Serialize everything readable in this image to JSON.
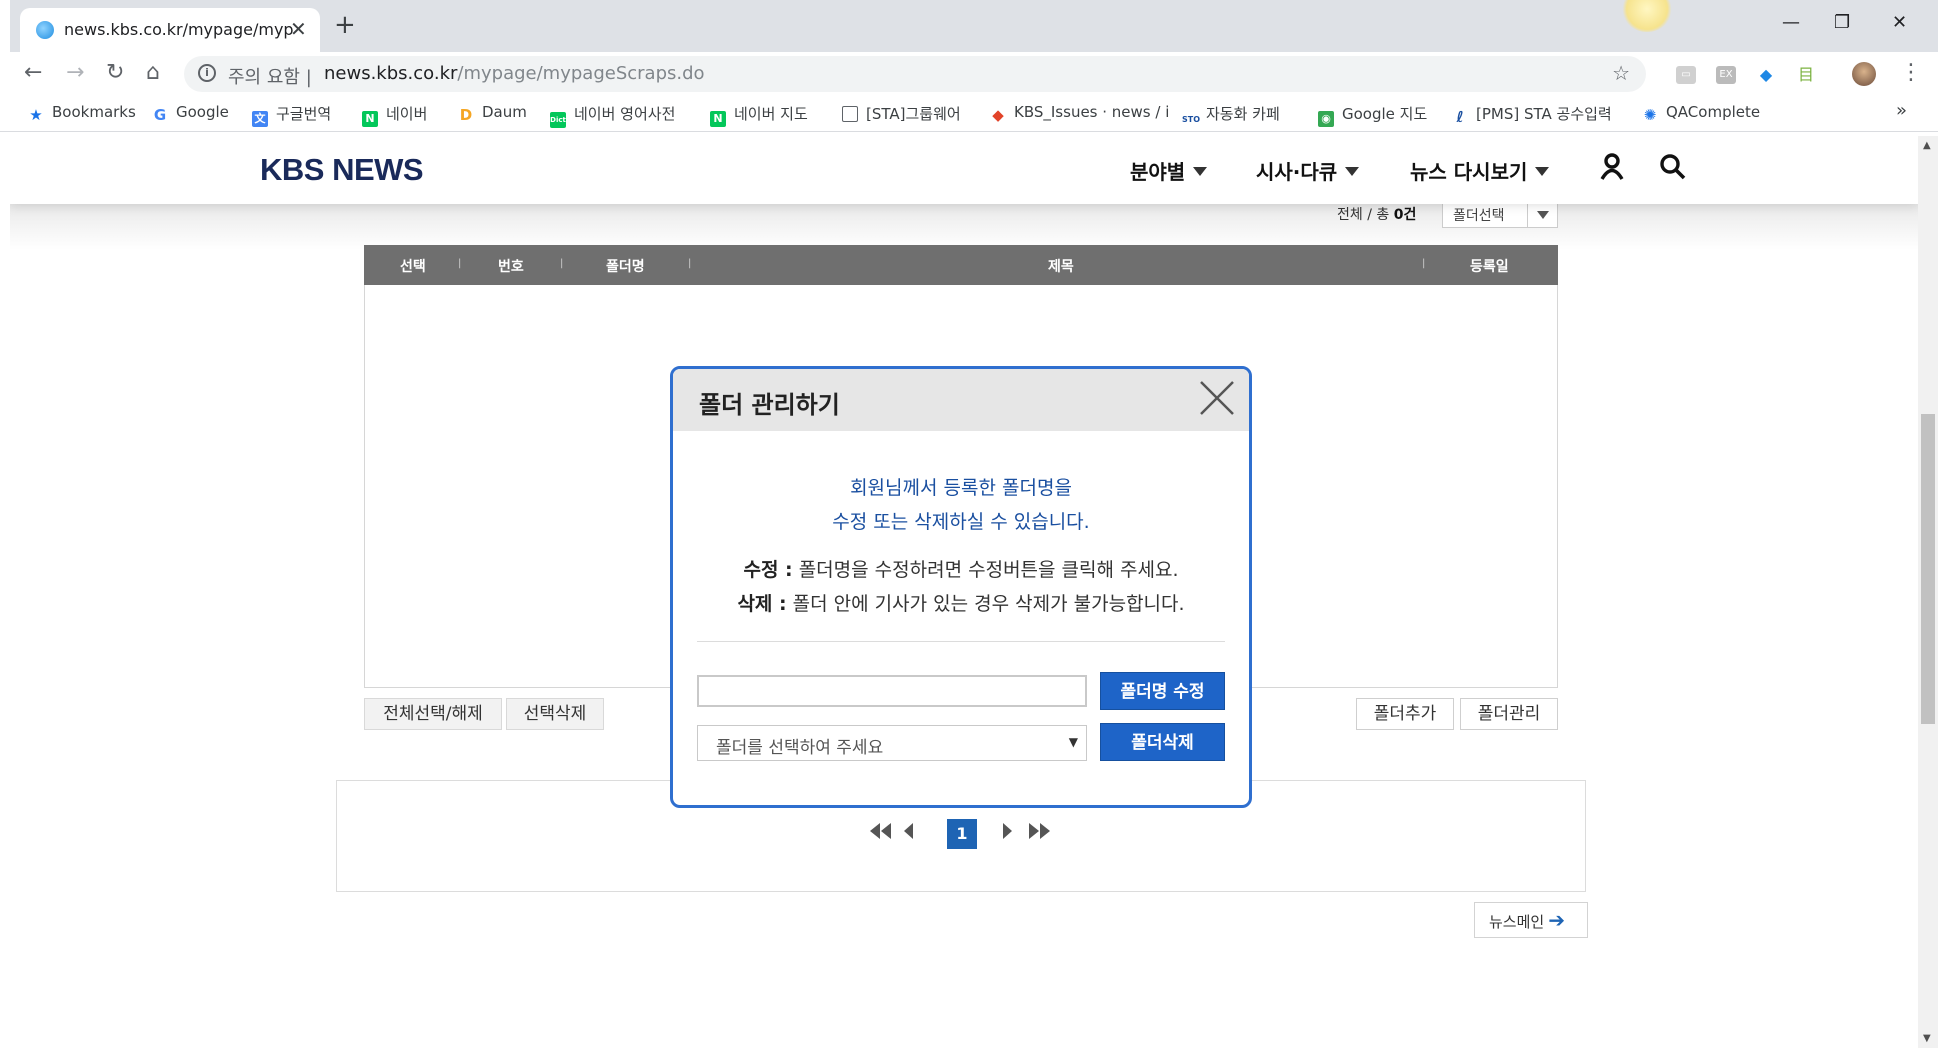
{
  "browser": {
    "tab_title": "news.kbs.co.kr/mypage/mypageScraps.do",
    "tab_close": "✕",
    "new_tab": "+",
    "security_warning": "주의 요함",
    "url_host": "news.kbs.co.kr",
    "url_path": "/mypage/mypageScraps.do",
    "bookmarks": [
      {
        "label": "Bookmarks",
        "icon": "star-icon",
        "color": "#1a73e8"
      },
      {
        "label": "Google",
        "icon": "google-icon",
        "color": "#4285f4"
      },
      {
        "label": "구글번역",
        "icon": "translate-icon",
        "color": "#4285f4"
      },
      {
        "label": "네이버",
        "icon": "naver-icon",
        "color": "#03c75a"
      },
      {
        "label": "Daum",
        "icon": "daum-icon",
        "color": "#f5a623"
      },
      {
        "label": "네이버 영어사전",
        "icon": "naver-dict-icon",
        "color": "#03c75a"
      },
      {
        "label": "네이버 지도",
        "icon": "naver-map-icon",
        "color": "#03c75a"
      },
      {
        "label": "[STA]그룹웨어",
        "icon": "page-icon",
        "color": "#5f6368"
      },
      {
        "label": "KBS_Issues · news / i",
        "icon": "gitlab-icon",
        "color": "#e24329"
      },
      {
        "label": "자동화 카페",
        "icon": "cafe-icon",
        "color": "#1a4fa0"
      },
      {
        "label": "Google 지도",
        "icon": "google-maps-icon",
        "color": "#34a853"
      },
      {
        "label": "[PMS] STA 공수입력",
        "icon": "pms-icon",
        "color": "#1a4fa0"
      },
      {
        "label": "QAComplete",
        "icon": "qacomplete-icon",
        "color": "#1a73e8"
      }
    ],
    "more_bookmarks": "»"
  },
  "header": {
    "logo": "KBS NEWS",
    "nav": [
      "분야별",
      "시사·다큐",
      "뉴스 다시보기"
    ]
  },
  "list": {
    "count_prefix": "전체 / 총",
    "count_value": "0건",
    "folder_select": "폴더선택",
    "columns": [
      "선택",
      "번호",
      "폴더명",
      "제목",
      "등록일"
    ],
    "btn_select_all": "전체선택/해제",
    "btn_delete_selected": "선택삭제",
    "btn_add_folder": "폴더추가",
    "btn_manage_folder": "폴더관리"
  },
  "paging": {
    "current_page": "1"
  },
  "news_main": "뉴스메인",
  "modal": {
    "title": "폴더 관리하기",
    "desc_line1": "회원님께서 등록한 폴더명을",
    "desc_line2": "수정 또는 삭제하실 수 있습니다.",
    "note_edit_label": "수정 :",
    "note_edit_text": "폴더명을 수정하려면 수정버튼을 클릭해 주세요.",
    "note_delete_label": "삭제 :",
    "note_delete_text": "폴더 안에 기사가 있는 경우 삭제가 불가능합니다.",
    "input_value": "",
    "btn_rename": "폴더명 수정",
    "select_placeholder": "폴더를 선택하여 주세요",
    "btn_delete": "폴더삭제"
  },
  "colors": {
    "accent": "#1e64c8",
    "modal_border": "#2f6fcf",
    "table_header": "#6f6f6f"
  }
}
